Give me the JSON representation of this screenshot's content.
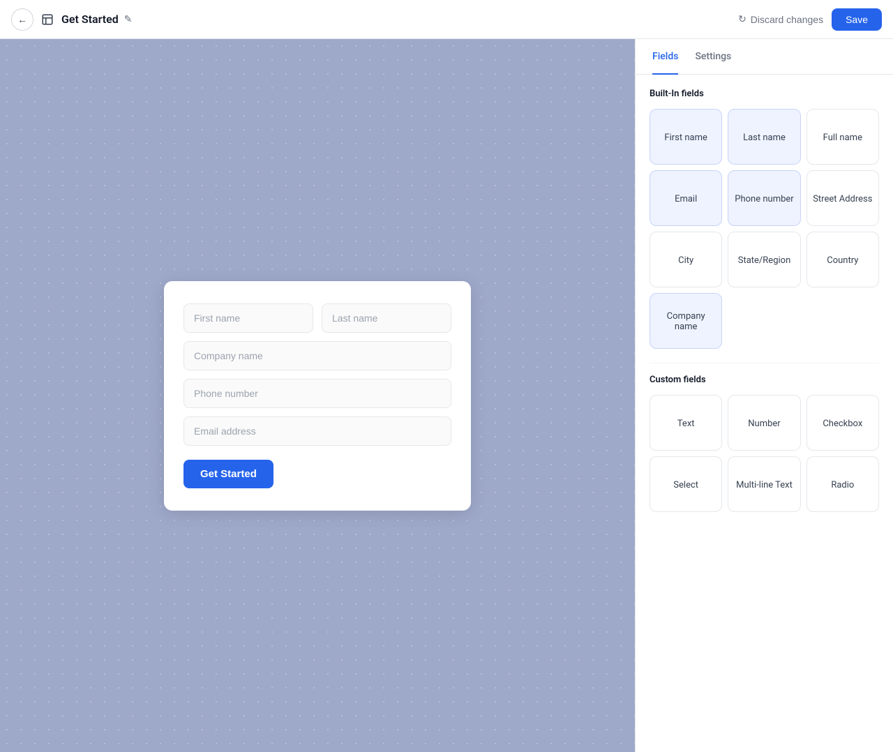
{
  "topbar": {
    "title": "Get Started",
    "discard_label": "Discard changes",
    "save_label": "Save"
  },
  "tabs": {
    "fields_label": "Fields",
    "settings_label": "Settings",
    "active": "fields"
  },
  "builtin_section": {
    "title": "Built-In fields"
  },
  "builtin_fields": [
    {
      "label": "First name",
      "highlighted": true
    },
    {
      "label": "Last name",
      "highlighted": true
    },
    {
      "label": "Full name",
      "highlighted": false
    },
    {
      "label": "Email",
      "highlighted": true
    },
    {
      "label": "Phone number",
      "highlighted": true
    },
    {
      "label": "Street Address",
      "highlighted": false
    },
    {
      "label": "City",
      "highlighted": false
    },
    {
      "label": "State/Region",
      "highlighted": false
    },
    {
      "label": "Country",
      "highlighted": false
    },
    {
      "label": "Company name",
      "highlighted": true
    }
  ],
  "custom_section": {
    "title": "Custom fields"
  },
  "custom_fields": [
    {
      "label": "Text",
      "highlighted": false
    },
    {
      "label": "Number",
      "highlighted": false
    },
    {
      "label": "Checkbox",
      "highlighted": false
    },
    {
      "label": "Select",
      "highlighted": false
    },
    {
      "label": "Multi-line Text",
      "highlighted": false
    },
    {
      "label": "Radio",
      "highlighted": false
    }
  ],
  "form": {
    "first_name_placeholder": "First name",
    "last_name_placeholder": "Last name",
    "company_name_placeholder": "Company name",
    "phone_placeholder": "Phone number",
    "email_placeholder": "Email address",
    "submit_label": "Get Started"
  }
}
